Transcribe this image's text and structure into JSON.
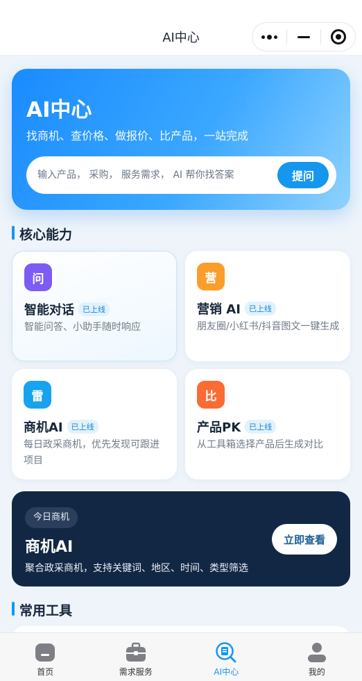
{
  "nav": {
    "title": "AI中心"
  },
  "hero": {
    "title": "AI中心",
    "subtitle": "找商机、查价格、做报价、比产品，一站完成",
    "search_placeholder": "输入产品， 采购， 服务需求， AI 帮你找答案",
    "search_value": "",
    "ask_label": "提问"
  },
  "core": {
    "title": "核心能力",
    "cards": [
      {
        "icon_char": "问",
        "icon_color": "#7c5cf5",
        "title": "智能对话",
        "badge": "已上线",
        "desc": "智能问答、小助手随时响应"
      },
      {
        "icon_char": "营",
        "icon_color": "#fb9d2a",
        "title": "营销 AI",
        "badge": "已上线",
        "desc": "朋友圈/小红书/抖音图文一键生成"
      },
      {
        "icon_char": "雷",
        "icon_color": "#18a3ef",
        "title": "商机AI",
        "badge": "已上线",
        "desc": "每日政采商机，优先发现可跟进项目"
      },
      {
        "icon_char": "比",
        "icon_color": "#fb6b34",
        "title": "产品PK",
        "badge": "已上线",
        "desc": "从工具箱选择产品后生成对比"
      }
    ]
  },
  "promo": {
    "tag": "今日商机",
    "title": "商机AI",
    "desc": "聚合政采商机，支持关键词、地区、时间、类型筛选",
    "button": "立即查看"
  },
  "tools": {
    "title": "常用工具"
  },
  "tabbar": {
    "items": [
      {
        "label": "首页",
        "icon": "home-icon"
      },
      {
        "label": "需求服务",
        "icon": "toolbox-icon"
      },
      {
        "label": "AI中心",
        "icon": "ai-search-icon"
      },
      {
        "label": "我的",
        "icon": "user-icon"
      }
    ]
  },
  "colors": {
    "accent": "#1597f0",
    "promo_bg": "#122744"
  }
}
